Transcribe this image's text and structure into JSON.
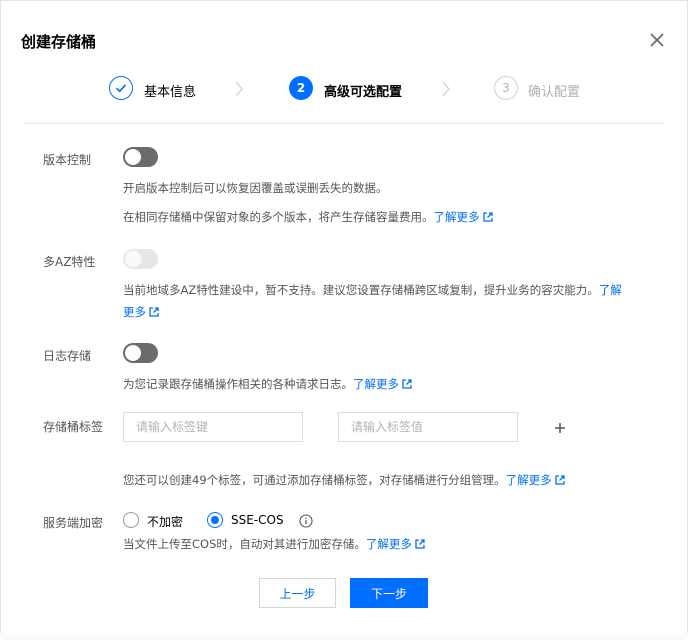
{
  "dialog": {
    "title": "创建存储桶",
    "close_icon": "close-icon"
  },
  "steps": [
    {
      "indicator": "",
      "label": "基本信息",
      "state": "done"
    },
    {
      "indicator": "2",
      "label": "高级可选配置",
      "state": "active"
    },
    {
      "indicator": "3",
      "label": "确认配置",
      "state": "pending"
    }
  ],
  "versioning": {
    "label": "版本控制",
    "enabled": false,
    "desc_1": "开启版本控制后可以恢复因覆盖或误删丢失的数据。",
    "desc_2": "在相同存储桶中保留对象的多个版本，将产生存储容量费用。",
    "link": "了解更多"
  },
  "multi_az": {
    "label": "多AZ特性",
    "enabled": false,
    "disabled": true,
    "desc_line1": "当前地域多AZ特性建设中，暂不支持。建议您设置存储桶跨区域复制，提升业务的容灾能力。",
    "link_part1": "了解",
    "link_part2": "更多"
  },
  "logging": {
    "label": "日志存储",
    "enabled": false,
    "desc": "为您记录跟存储桶操作相关的各种请求日志。",
    "link": "了解更多"
  },
  "tags": {
    "label": "存储桶标签",
    "key_placeholder": "请输入标签键",
    "value_placeholder": "请输入标签值",
    "add_icon": "plus-icon",
    "desc": "您还可以创建49个标签，可通过添加存储桶标签，对存储桶进行分组管理。",
    "link": "了解更多"
  },
  "encryption": {
    "label": "服务端加密",
    "options": [
      {
        "label": "不加密",
        "selected": false
      },
      {
        "label": "SSE-COS",
        "selected": true
      }
    ],
    "info_icon": "info-icon",
    "desc": "当文件上传至COS时，自动对其进行加密存储。",
    "link": "了解更多"
  },
  "footer": {
    "prev_label": "上一步",
    "next_label": "下一步"
  },
  "colors": {
    "accent": "#006eff",
    "toggle_off": "#6b6b6b",
    "toggle_disabled": "#e6e6e6",
    "text_secondary": "#555555"
  }
}
